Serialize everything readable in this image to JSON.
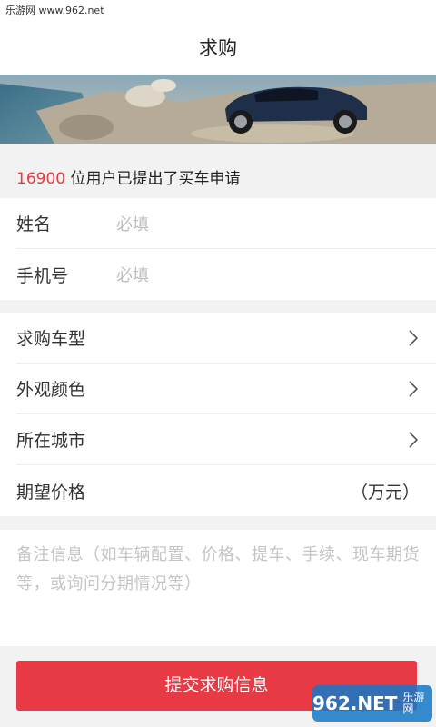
{
  "status_bar": {
    "site_text": "乐游网 www.962.net"
  },
  "header": {
    "title": "求购"
  },
  "stats": {
    "count": "16900",
    "text": " 位用户已提出了买车申请"
  },
  "contact": {
    "name_label": "姓名",
    "name_placeholder": "必填",
    "phone_label": "手机号",
    "phone_placeholder": "必填"
  },
  "car_options": {
    "model_label": "求购车型",
    "color_label": "外观颜色",
    "city_label": "所在城市",
    "price_label": "期望价格",
    "price_unit": "（万元）"
  },
  "remarks": {
    "placeholder": "备注信息（如车辆配置、价格、提车、手续、现车期货等，或询问分期情况等）"
  },
  "submit": {
    "label": "提交求购信息"
  },
  "watermark": {
    "brand": "962.NET",
    "sub": "乐游网"
  },
  "colors": {
    "accent": "#e83a45",
    "placeholder": "#bdbdbd"
  }
}
